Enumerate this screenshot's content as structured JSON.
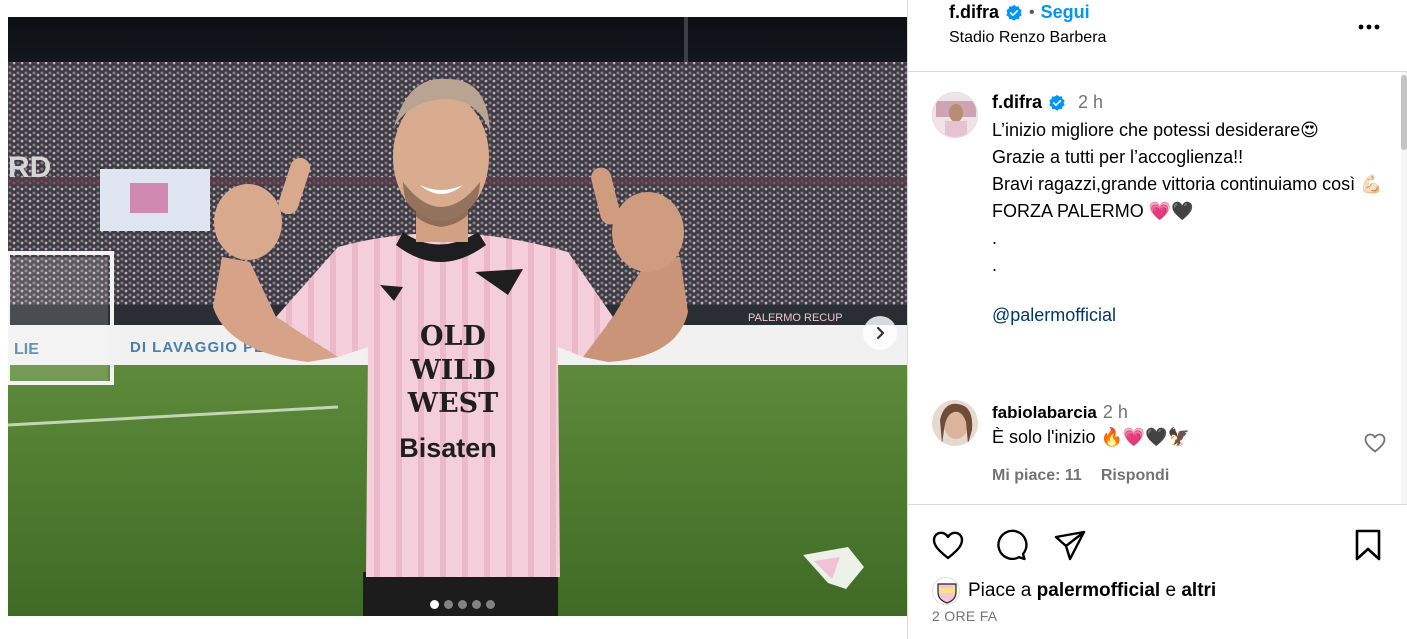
{
  "post": {
    "username": "f.difra",
    "follow_label": "Segui",
    "dot_separator": "•",
    "location": "Stadio Renzo Barbera",
    "carousel": {
      "slide_count": 5,
      "active_index": 0
    },
    "sponsor_text": {
      "line1": "OLD",
      "line2": "WILD",
      "line3": "WEST",
      "line4": "Bisaten"
    },
    "banner_text": {
      "left": "LIE",
      "middle": "DI LAVAGGIO PER LAVAS",
      "right_top": "PALERMO   RECUP",
      "stand": "RD"
    }
  },
  "caption": {
    "username": "f.difra",
    "time": "2 h",
    "text": "L’inizio migliore che potessi desiderare😍\nGrazie a tutti per l’accoglienza!!\nBravi ragazzi,grande vittoria continuiamo così 💪🏻\nFORZA PALERMO 💗🖤\n.\n.",
    "mention": "@palermofficial"
  },
  "comment": {
    "username": "fabiolabarcia",
    "time": "2 h",
    "text": "È solo l'inizio 🔥💗🖤🦅",
    "likes_label": "Mi piace: 11",
    "reply_label": "Rispondi"
  },
  "actions": {
    "liked_by_prefix": "Piace a",
    "liked_by_user": "palermofficial",
    "liked_by_joiner": "e",
    "liked_by_others": "altri",
    "date": "2 ORE FA"
  },
  "colors": {
    "accent_blue": "#0095f6",
    "mention_blue": "#00376b",
    "jersey_pink": "#f2c9d6",
    "grey_text": "#737373",
    "border": "#dbdbdb"
  },
  "icons": {
    "verified": "verified-badge-icon",
    "more": "more-options-icon",
    "next": "chevron-right-icon",
    "like": "heart-icon",
    "comment": "comment-bubble-icon",
    "share": "paper-plane-icon",
    "save": "bookmark-icon"
  }
}
